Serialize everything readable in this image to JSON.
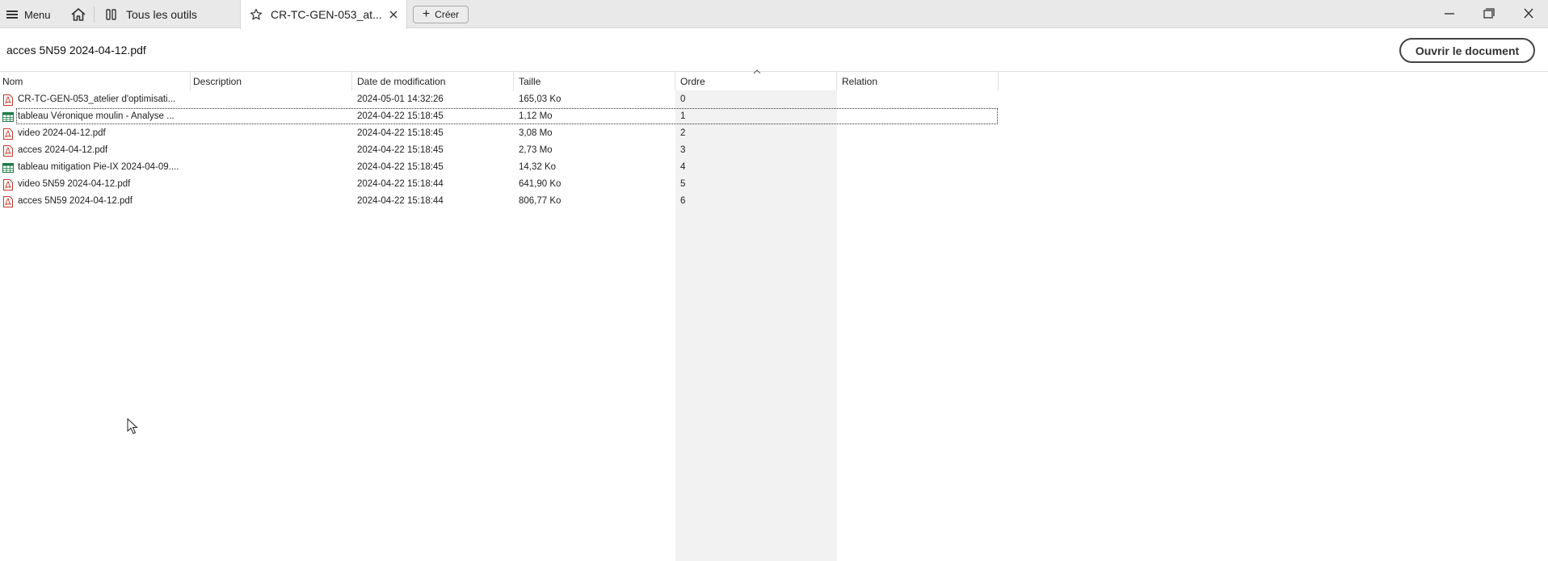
{
  "topbar": {
    "menu_label": "Menu",
    "tools_tab": "Tous les outils",
    "active_tab": "CR-TC-GEN-053_at...",
    "create_label": "Créer"
  },
  "header": {
    "doc_title": "acces 5N59 2024-04-12.pdf",
    "open_button": "Ouvrir le document"
  },
  "table": {
    "columns": [
      "Nom",
      "Description",
      "Date de modification",
      "Taille",
      "Ordre",
      "Relation"
    ],
    "rows": [
      {
        "name": "CR-TC-GEN-053_atelier d'optimisati...",
        "description": "",
        "date": "2024-05-01 14:32:26",
        "size": "165,03 Ko",
        "order": "0",
        "relation": "",
        "icon": "pdf-icon"
      },
      {
        "name": "tableau Véronique moulin - Analyse ...",
        "description": "",
        "date": "2024-04-22 15:18:45",
        "size": "1,12 Mo",
        "order": "1",
        "relation": "",
        "icon": "spreadsheet-icon"
      },
      {
        "name": "video 2024-04-12.pdf",
        "description": "",
        "date": "2024-04-22 15:18:45",
        "size": "3,08 Mo",
        "order": "2",
        "relation": "",
        "icon": "pdf-icon"
      },
      {
        "name": "acces 2024-04-12.pdf",
        "description": "",
        "date": "2024-04-22 15:18:45",
        "size": "2,73 Mo",
        "order": "3",
        "relation": "",
        "icon": "pdf-icon"
      },
      {
        "name": "tableau mitigation Pie-IX 2024-04-09....",
        "description": "",
        "date": "2024-04-22 15:18:45",
        "size": "14,32 Ko",
        "order": "4",
        "relation": "",
        "icon": "spreadsheet-icon"
      },
      {
        "name": "video 5N59 2024-04-12.pdf",
        "description": "",
        "date": "2024-04-22 15:18:44",
        "size": "641,90 Ko",
        "order": "5",
        "relation": "",
        "icon": "pdf-icon"
      },
      {
        "name": "acces 5N59 2024-04-12.pdf",
        "description": "",
        "date": "2024-04-22 15:18:44",
        "size": "806,77 Ko",
        "order": "6",
        "relation": "",
        "icon": "pdf-icon"
      }
    ]
  },
  "colors": {
    "pdf": "#c0392b",
    "sheet": "#1e7b45",
    "order_band": "#f2f2f2"
  }
}
